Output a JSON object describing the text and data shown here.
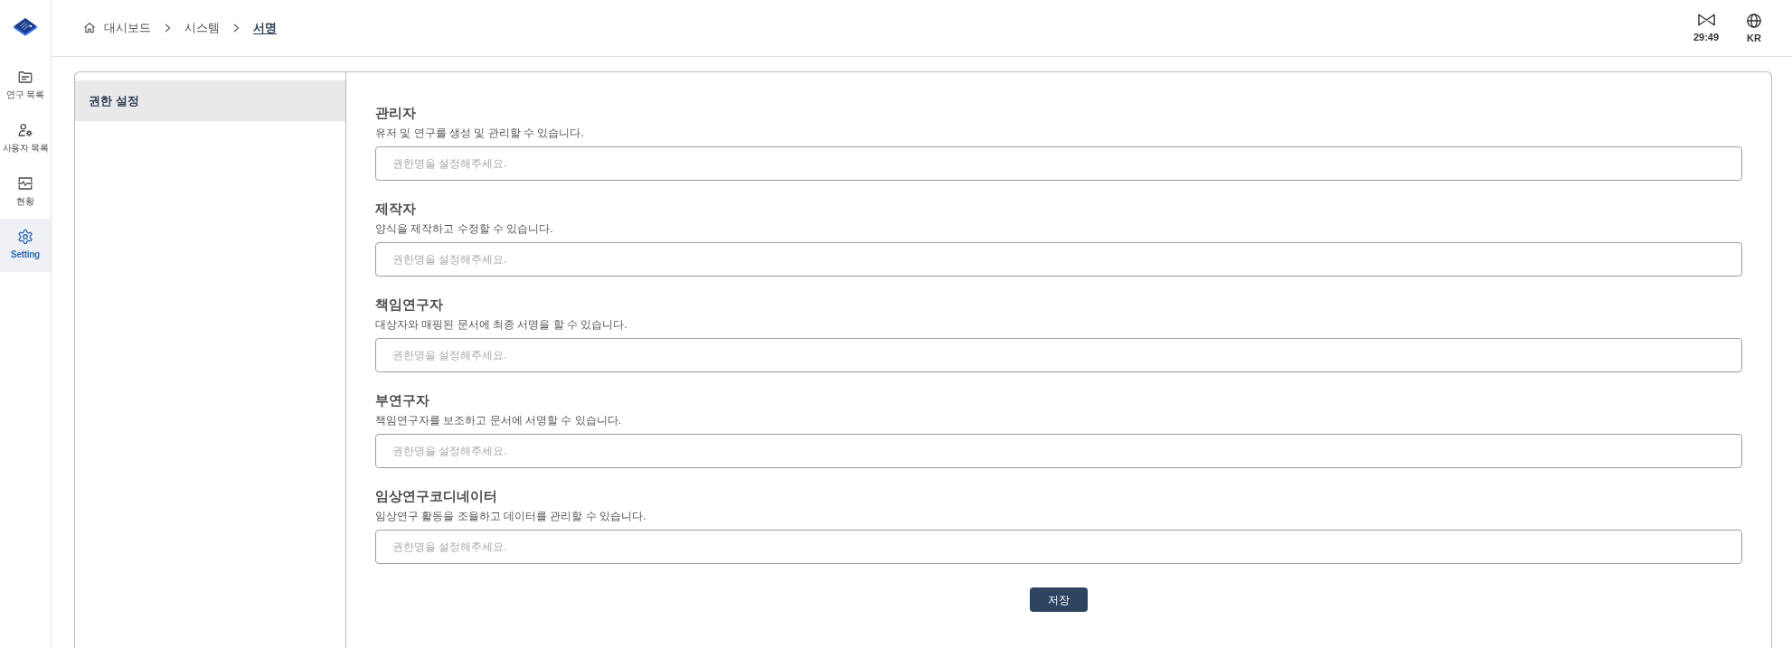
{
  "sidebar": {
    "items": [
      {
        "label": "연구 목록",
        "selected": false
      },
      {
        "label": "사용자 목록",
        "selected": false
      },
      {
        "label": "현황",
        "selected": false
      },
      {
        "label": "Setting",
        "selected": true
      }
    ]
  },
  "breadcrumb": [
    {
      "label": "대시보드",
      "selected": false
    },
    {
      "label": "시스템",
      "selected": false
    },
    {
      "label": "서명",
      "selected": true
    }
  ],
  "header_tools": {
    "session_timer": "29:49",
    "language": "KR"
  },
  "settings_menu": [
    {
      "label": "권한 설정",
      "selected": true
    }
  ],
  "roles": [
    {
      "title": "관리자",
      "description": "유저 및 연구를 생성 및 관리할 수 있습니다.",
      "placeholder": "권한명을 설정해주세요."
    },
    {
      "title": "제작자",
      "description": "양식을 제작하고 수정할 수 있습니다.",
      "placeholder": "권한명을 설정해주세요."
    },
    {
      "title": "책임연구자",
      "description": "대상자와 매핑된 문서에 최종 서명을 할 수 있습니다.",
      "placeholder": "권한명을 설정해주세요."
    },
    {
      "title": "부연구자",
      "description": "책임연구자를 보조하고 문서에 서명할 수 있습니다.",
      "placeholder": "권한명을 설정해주세요."
    },
    {
      "title": "임상연구코디네이터",
      "description": "임상연구 활동을 조율하고 데이터를 관리할 수 있습니다.",
      "placeholder": "권한명을 설정해주세요."
    }
  ],
  "save_button": "저장"
}
